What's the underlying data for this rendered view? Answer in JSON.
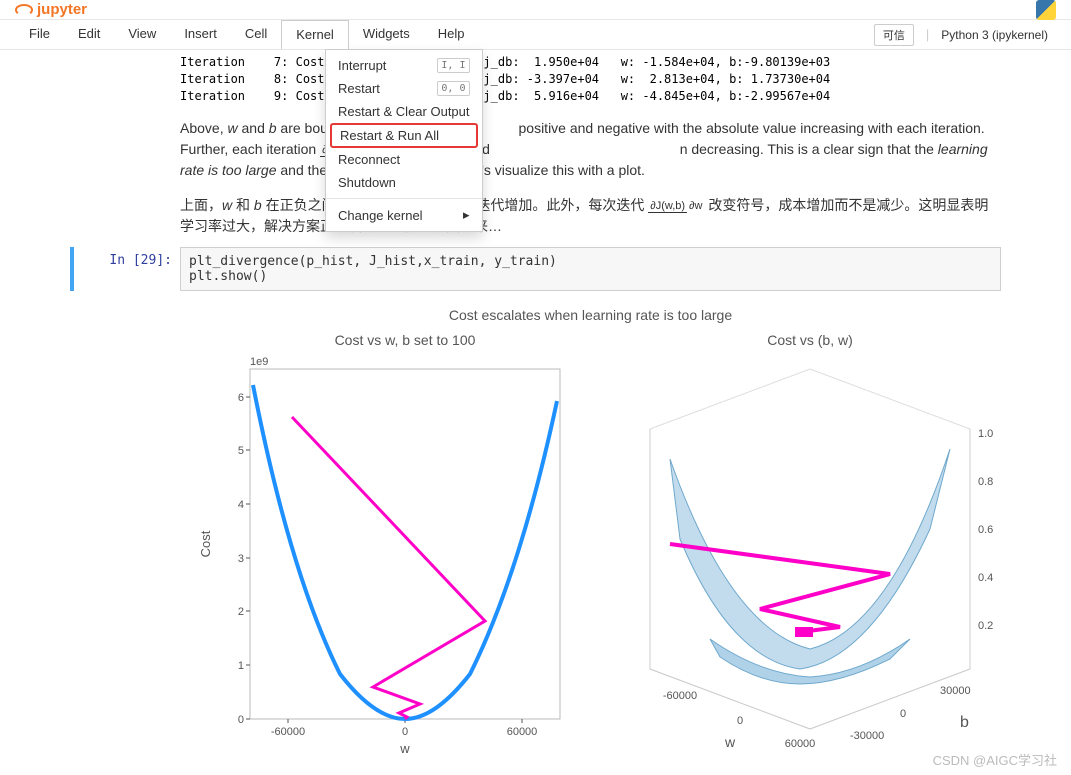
{
  "header": {
    "logo_text": "jupyter"
  },
  "menubar": {
    "items": [
      "File",
      "Edit",
      "View",
      "Insert",
      "Cell",
      "Kernel",
      "Widgets",
      "Help"
    ],
    "trusted": "可信",
    "kernel": "Python 3 (ipykernel)"
  },
  "dropdown": {
    "items": [
      {
        "label": "Interrupt",
        "shortcut": "I, I"
      },
      {
        "label": "Restart",
        "shortcut": "0, 0"
      },
      {
        "label": "Restart & Clear Output"
      },
      {
        "label": "Restart & Run All",
        "highlighted": true
      },
      {
        "label": "Reconnect"
      },
      {
        "label": "Shutdown"
      }
    ],
    "change_kernel": "Change kernel"
  },
  "output_lines": [
    "Iteration    7: Cost             i6e+04, dj_db:  1.950e+04   w: -1.584e+04, b:-9.80139e+03",
    "Iteration    8: Cost             i6e+04, dj_db: -3.397e+04   w:  2.813e+04, b: 1.73730e+04",
    "Iteration    9: Cost             i2e+04, dj_db:  5.916e+04   w: -4.845e+04, b:-2.99567e+04"
  ],
  "text_en": {
    "part1": "Above, ",
    "w": "w",
    "and": " and ",
    "b": "b",
    "part2": " are boun",
    "part3": " positive and negative with the absolute value increasing with each iteration. Further, each iteration ",
    "frac_num": "∂J(w,b)",
    "frac_den": "∂w",
    "part4": " changes sign and",
    "part5": "n decreasing. This is a clear sign that the ",
    "italic": "learning rate is too large",
    "part6": " and the solution is diverging. Let's visualize this with a plot."
  },
  "text_zh": {
    "part1": "上面，",
    "w": "w",
    "and": " 和 ",
    "b": "b",
    "part2": " 在正负之间",
    "part3": "迭代增加。此外，每次迭代 ",
    "frac_num": "∂J(w,b)",
    "frac_den": "∂w",
    "part4": " 改变符号，成本增加而不是减少。这明显表明学习率过大，解决方案正在发散。让我们用图表来…"
  },
  "code_cell": {
    "prompt": "In  [29]:",
    "code": "plt_divergence(p_hist, J_hist,x_train, y_train)\nplt.show()"
  },
  "watermark": "CSDN @AIGC学习社",
  "chart_data": [
    {
      "type": "line",
      "suptitle": "Cost escalates when learning rate is too large",
      "title": "Cost vs w, b set to 100",
      "xlabel": "w",
      "ylabel": "Cost",
      "y_scale_label": "1e9",
      "xlim": [
        -80000,
        80000
      ],
      "ylim": [
        0,
        6.5
      ],
      "xticks": [
        -60000,
        0,
        60000
      ],
      "yticks": [
        0,
        1,
        2,
        3,
        4,
        5,
        6
      ],
      "series": [
        {
          "name": "cost-curve",
          "color": "#1e90ff",
          "x": [
            -78000,
            -60000,
            -40000,
            -20000,
            0,
            20000,
            40000,
            60000,
            78000
          ],
          "y": [
            6.2,
            3.6,
            1.6,
            0.4,
            0.0,
            0.4,
            1.6,
            3.6,
            5.9
          ]
        },
        {
          "name": "divergence-path",
          "color": "#ff00c8",
          "x": [
            -60000,
            42000,
            -18000,
            8000,
            -3000,
            1000,
            0
          ],
          "y": [
            5.6,
            1.8,
            0.55,
            0.3,
            0.12,
            0.05,
            0.0
          ]
        }
      ]
    },
    {
      "type": "surface",
      "title": "Cost vs (b, w)",
      "xlabel": "w",
      "ylabel": "b",
      "xticks_w": [
        -60000,
        0,
        60000
      ],
      "xticks_b": [
        -30000,
        0,
        30000
      ],
      "zticks": [
        0.2,
        0.4,
        0.6,
        0.8,
        1.0
      ],
      "path_color": "#ff00c8",
      "surface_color": "#8fbfe0"
    }
  ]
}
